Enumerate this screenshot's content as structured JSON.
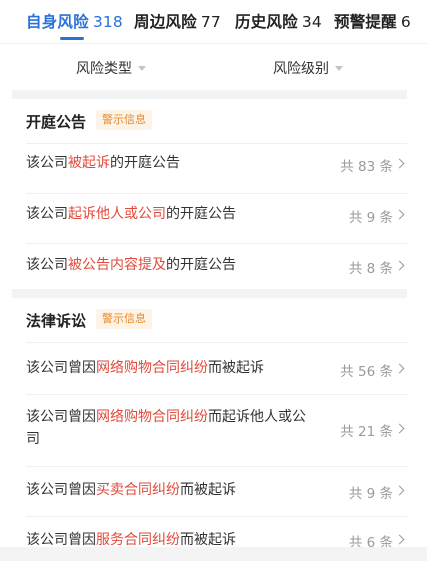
{
  "tabs": [
    {
      "label": "自身风险",
      "count": "318"
    },
    {
      "label": "周边风险",
      "count": "77"
    },
    {
      "label": "历史风险",
      "count": "34"
    },
    {
      "label": "预警提醒",
      "count": "6"
    }
  ],
  "filters": [
    {
      "label": "风险类型"
    },
    {
      "label": "风险级别"
    }
  ],
  "sections": [
    {
      "title": "开庭公告",
      "tag": "警示信息",
      "rows": [
        {
          "prefix": "该公司",
          "highlight": "被起诉",
          "suffix": "的开庭公告",
          "count": "共 83 条"
        },
        {
          "prefix": "该公司",
          "highlight": "起诉他人或公司",
          "suffix": "的开庭公告",
          "count": "共 9 条"
        },
        {
          "prefix": "该公司",
          "highlight": "被公告内容提及",
          "suffix": "的开庭公告",
          "count": "共 8 条"
        }
      ]
    },
    {
      "title": "法律诉讼",
      "tag": "警示信息",
      "rows": [
        {
          "prefix": "该公司曾因",
          "highlight": "网络购物合同纠纷",
          "suffix": "而被起诉",
          "count": "共 56 条"
        },
        {
          "prefix": "该公司曾因",
          "highlight": "网络购物合同纠纷",
          "suffix": "而起诉他人或公司",
          "count": "共 21 条"
        },
        {
          "prefix": "该公司曾因",
          "highlight": "买卖合同纠纷",
          "suffix": "而被起诉",
          "count": "共 9 条"
        },
        {
          "prefix": "该公司曾因",
          "highlight": "服务合同纠纷",
          "suffix": "而被起诉",
          "count": "共 6 条"
        }
      ]
    }
  ],
  "colors": {
    "accent": "#2a72d9",
    "highlight": "#e24a3b",
    "tag_text": "#e8892e",
    "tag_bg": "#fdf3e6"
  }
}
